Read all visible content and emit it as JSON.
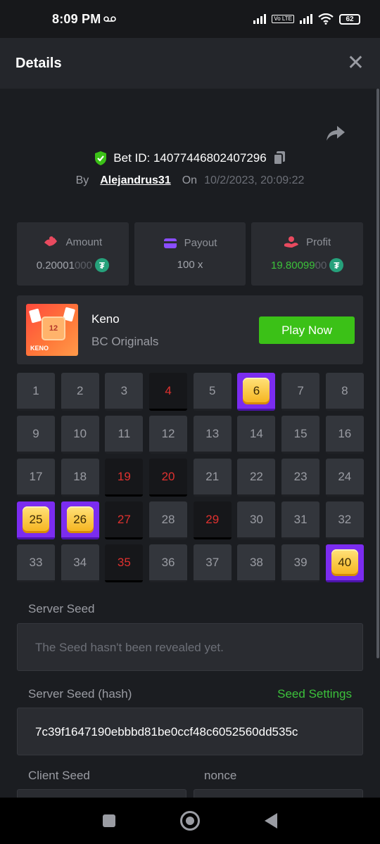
{
  "status_bar": {
    "time": "8:09 PM",
    "voicemail_icon": "voicemail-icon",
    "volte": "Vo LTE",
    "battery": "62"
  },
  "header": {
    "title": "Details",
    "close_icon": "close-icon"
  },
  "bet": {
    "bet_id_label": "Bet ID: 14077446802407296",
    "by_label": "By",
    "username": "Alejandrus31",
    "on_label": "On",
    "date": "10/2/2023, 20:09:22"
  },
  "stats": [
    {
      "label": "Amount",
      "value_main": "0.20001",
      "value_dim": "000",
      "color": "#e84a5f",
      "icon": "amount-icon",
      "coin": "₮"
    },
    {
      "label": "Payout",
      "value_main": "100 x",
      "value_dim": "",
      "color": "#8a4dff",
      "icon": "wallet-icon"
    },
    {
      "label": "Profit",
      "value_main": "19.80099",
      "value_dim": "00",
      "color": "#e84a5f",
      "icon": "profit-icon",
      "coin": "₮"
    }
  ],
  "game": {
    "name": "Keno",
    "provider": "BC Originals",
    "play_label": "Play Now",
    "thumb_text": "KENO",
    "thumb_number": "12"
  },
  "grid": {
    "numbers": [
      "1",
      "2",
      "3",
      "4",
      "5",
      "6",
      "7",
      "8",
      "9",
      "10",
      "11",
      "12",
      "13",
      "14",
      "15",
      "16",
      "17",
      "18",
      "19",
      "20",
      "21",
      "22",
      "23",
      "24",
      "25",
      "26",
      "27",
      "28",
      "29",
      "30",
      "31",
      "32",
      "33",
      "34",
      "35",
      "36",
      "37",
      "38",
      "39",
      "40"
    ],
    "drawn": [
      4,
      19,
      20,
      27,
      29,
      35
    ],
    "hits": [
      6,
      25,
      26,
      40
    ]
  },
  "seeds": {
    "server_seed_label": "Server Seed",
    "server_seed_value": "The Seed hasn't been revealed yet.",
    "server_hash_label": "Server Seed (hash)",
    "seed_settings_label": "Seed Settings",
    "server_hash_value": "7c39f1647190ebbbd81be0ccf48c6052560dd535c",
    "client_seed_label": "Client Seed",
    "nonce_label": "nonce"
  },
  "colors": {
    "accent_green": "#3bc117",
    "hit_purple": "#7b2cf0",
    "drawn_red": "#e0312f"
  }
}
